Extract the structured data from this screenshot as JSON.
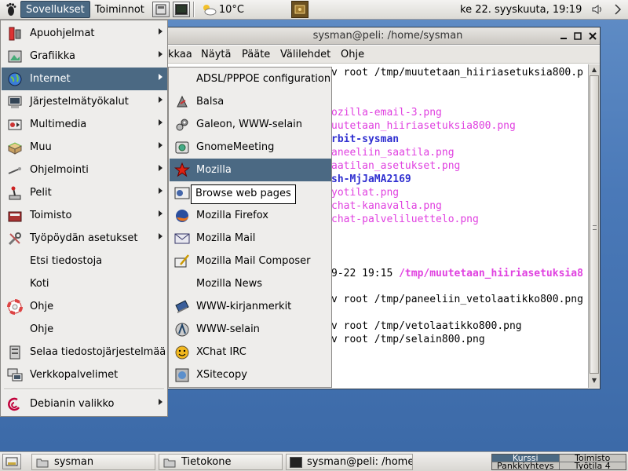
{
  "top_panel": {
    "applications_label": "Sovellukset",
    "actions_label": "Toiminnot",
    "weather_temp": "10°C",
    "clock": "ke 22. syyskuuta, 19:19"
  },
  "terminal": {
    "title": "sysman@peli: /home/sysman",
    "menu": [
      "kkaa",
      "Näytä",
      "Pääte",
      "Välilehdet",
      "Ohje"
    ],
    "lines": [
      {
        "text": "v root /tmp/muutetaan_hiiriasetuksia800.p",
        "cls": ""
      },
      {
        "text": "ozilla-email-3.png",
        "cls": "pink"
      },
      {
        "text": "uutetaan_hiiriasetuksia800.png",
        "cls": "pink"
      },
      {
        "text": "rbit-sysman",
        "cls": "blue"
      },
      {
        "text": "aneeliin_saatila.png",
        "cls": "pink"
      },
      {
        "text": "aatilan_asetukset.png",
        "cls": "pink"
      },
      {
        "text": "sh-MjJaMA2169",
        "cls": "blue"
      },
      {
        "text": "yotilat.png",
        "cls": "pink"
      },
      {
        "text": "chat-kanavalla.png",
        "cls": "pink"
      },
      {
        "text": "chat-palveliluettelo.png",
        "cls": "pink"
      },
      {
        "text": "9-22 19:15 ",
        "cls": "",
        "suffix": "/tmp/muutetaan_hiiriasetuksia8"
      },
      {
        "text": "v root /tmp/paneeliin_vetolaatikko800.png",
        "cls": ""
      },
      {
        "text": "v root /tmp/vetolaatikko800.png",
        "cls": ""
      },
      {
        "text": "v root /tmp/selain800.png",
        "cls": ""
      }
    ]
  },
  "main_menu": {
    "items": [
      {
        "label": "Apuohjelmat",
        "icon": "accessories-icon",
        "submenu": true
      },
      {
        "label": "Grafiikka",
        "icon": "graphics-icon",
        "submenu": true
      },
      {
        "label": "Internet",
        "icon": "internet-globe-icon",
        "submenu": true,
        "active": true
      },
      {
        "label": "Järjestelmätyökalut",
        "icon": "system-tools-icon",
        "submenu": true
      },
      {
        "label": "Multimedia",
        "icon": "multimedia-icon",
        "submenu": true
      },
      {
        "label": "Muu",
        "icon": "other-box-icon",
        "submenu": true
      },
      {
        "label": "Ohjelmointi",
        "icon": "programming-icon",
        "submenu": true
      },
      {
        "label": "Pelit",
        "icon": "games-joystick-icon",
        "submenu": true
      },
      {
        "label": "Toimisto",
        "icon": "office-icon",
        "submenu": true
      },
      {
        "label": "Työpöydän asetukset",
        "icon": "desktop-settings-icon",
        "submenu": true
      },
      {
        "label": "Etsi tiedostoja",
        "icon": "",
        "submenu": false
      },
      {
        "label": "Koti",
        "icon": "",
        "submenu": false
      },
      {
        "label": "Ohje",
        "icon": "help-lifebuoy-icon",
        "submenu": false
      },
      {
        "label": "Ohje",
        "icon": "",
        "submenu": false
      },
      {
        "label": "Selaa tiedostojärjestelmää",
        "icon": "filesystem-icon",
        "submenu": false
      },
      {
        "label": "Verkkopalvelimet",
        "icon": "network-servers-icon",
        "submenu": false
      },
      {
        "label": "Debianin valikko",
        "icon": "debian-swirl-icon",
        "submenu": true
      }
    ]
  },
  "internet_menu": {
    "items": [
      {
        "label": "ADSL/PPPOE configuration",
        "icon": ""
      },
      {
        "label": "Balsa",
        "icon": "balsa-icon"
      },
      {
        "label": "Galeon, WWW-selain",
        "icon": "galeon-icon"
      },
      {
        "label": "GnomeMeeting",
        "icon": "gnomemeeting-icon"
      },
      {
        "label": "Mozilla",
        "icon": "mozilla-star-icon",
        "active": true
      },
      {
        "label": "",
        "icon": "mozilla-browse-icon"
      },
      {
        "label": "Mozilla Firefox",
        "icon": "firefox-globe-icon"
      },
      {
        "label": "Mozilla Mail",
        "icon": "mail-envelope-icon"
      },
      {
        "label": "Mozilla Mail Composer",
        "icon": "mail-composer-icon"
      },
      {
        "label": "Mozilla News",
        "icon": ""
      },
      {
        "label": "WWW-kirjanmerkit",
        "icon": "bookmarks-icon"
      },
      {
        "label": "WWW-selain",
        "icon": "web-browser-icon"
      },
      {
        "label": "XChat IRC",
        "icon": "xchat-smiley-icon"
      },
      {
        "label": "XSitecopy",
        "icon": "xsitecopy-icon"
      }
    ]
  },
  "tooltip": "Browse web pages",
  "taskbar": {
    "tasks": [
      "sysman",
      "Tietokone",
      "sysman@peli: /home/"
    ],
    "pager": [
      "Kurssi",
      "Toimisto",
      "Pankkiyhteys",
      "Työtila 4"
    ]
  },
  "colors": {
    "menu_highlight": "#4b6983",
    "terminal_pink": "#e040e0",
    "terminal_blue": "#3030d0"
  }
}
